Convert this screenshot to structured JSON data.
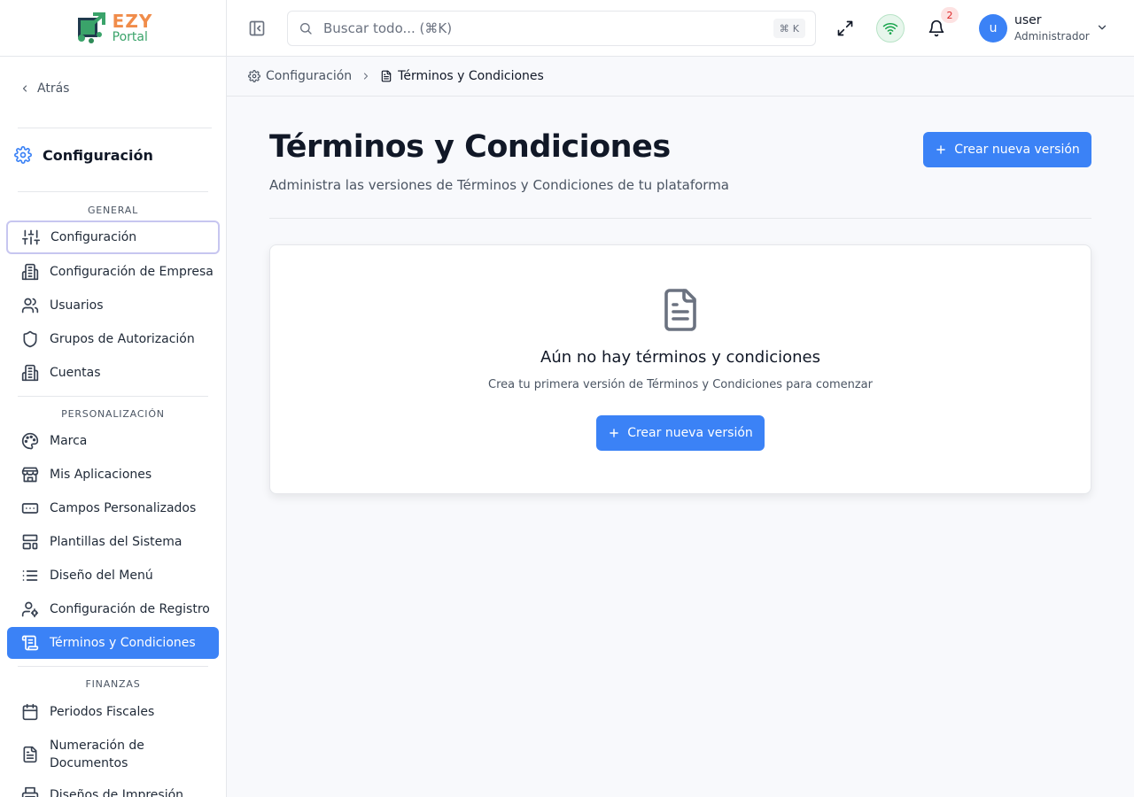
{
  "logo": {
    "line1": "EZY",
    "line2": "Portal"
  },
  "sidebar": {
    "back_label": "Atrás",
    "section_title": "Configuración",
    "groups": [
      {
        "label": "GENERAL",
        "items": [
          {
            "label": "Configuración",
            "icon": "sliders-icon"
          },
          {
            "label": "Configuración de Empresa",
            "icon": "building-icon"
          },
          {
            "label": "Usuarios",
            "icon": "users-icon"
          },
          {
            "label": "Grupos de Autorización",
            "icon": "shield-icon"
          },
          {
            "label": "Cuentas",
            "icon": "building-icon"
          }
        ]
      },
      {
        "label": "PERSONALIZACIÓN",
        "items": [
          {
            "label": "Marca",
            "icon": "palette-icon"
          },
          {
            "label": "Mis Aplicaciones",
            "icon": "store-icon"
          },
          {
            "label": "Campos Personalizados",
            "icon": "input-field-icon"
          },
          {
            "label": "Plantillas del Sistema",
            "icon": "layout-template-icon"
          },
          {
            "label": "Diseño del Menú",
            "icon": "list-icon"
          },
          {
            "label": "Configuración de Registro",
            "icon": "user-cog-icon"
          },
          {
            "label": "Términos y Condiciones",
            "icon": "scroll-text-icon",
            "active": true
          }
        ]
      },
      {
        "label": "FINANZAS",
        "items": [
          {
            "label": "Periodos Fiscales",
            "icon": "calendar-icon"
          },
          {
            "label": "Numeración de Documentos",
            "icon": "file-text-icon"
          },
          {
            "label": "Diseños de Impresión",
            "icon": "printer-icon"
          }
        ]
      }
    ]
  },
  "header": {
    "search_placeholder": "Buscar todo... (⌘K)",
    "shortcut_cmd": "⌘",
    "shortcut_key": "K",
    "notifications_count": "2",
    "user_initial": "u",
    "user_name": "user",
    "user_role": "Administrador"
  },
  "breadcrumb": {
    "parent": "Configuración",
    "current": "Términos y Condiciones"
  },
  "main": {
    "title": "Términos y Condiciones",
    "subtitle": "Administra las versiones de Términos y Condiciones de tu plataforma",
    "create_button": "Crear nueva versión",
    "empty_title": "Aún no hay términos y condiciones",
    "empty_subtitle": "Crea tu primera versión de Términos y Condiciones para comenzar",
    "empty_button": "Crear nueva versión"
  },
  "colors": {
    "primary": "#3b82f6",
    "logo_orange": "#f08c4a",
    "logo_green": "#3aa36a",
    "status_green": "#16a34a",
    "badge_red": "#dc2626"
  }
}
